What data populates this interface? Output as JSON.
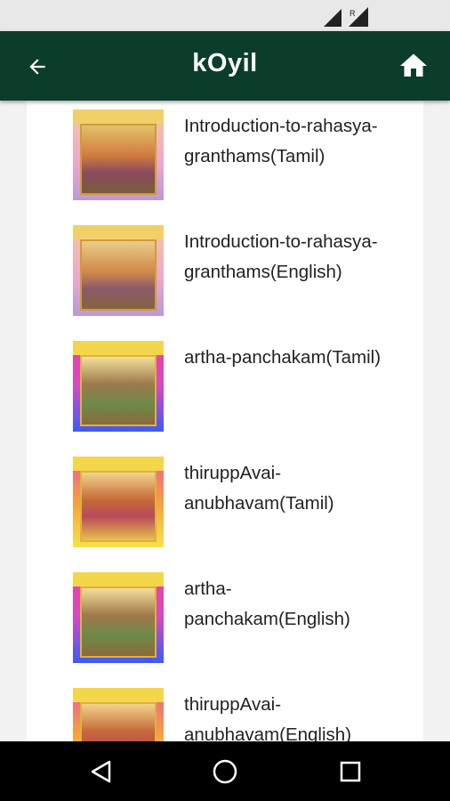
{
  "app": {
    "title": "kOyil"
  },
  "colors": {
    "app_bar": "#0b3d2b",
    "nav_bar": "#000000"
  },
  "icons": {
    "back": "arrow-left-icon",
    "home": "home-icon",
    "nav_back": "triangle-back-icon",
    "nav_home": "circle-home-icon",
    "nav_recents": "square-recents-icon"
  },
  "items": [
    {
      "label": "Introduction-to-rahasya-granthams(Tamil)"
    },
    {
      "label": "Introduction-to-rahasya-granthams(English)"
    },
    {
      "label": "artha-panchakam(Tamil)"
    },
    {
      "label": "thiruppAvai-anubhavam(Tamil)"
    },
    {
      "label": "artha-panchakam(English)"
    },
    {
      "label": "thiruppAvai-anubhavam(English)"
    }
  ]
}
